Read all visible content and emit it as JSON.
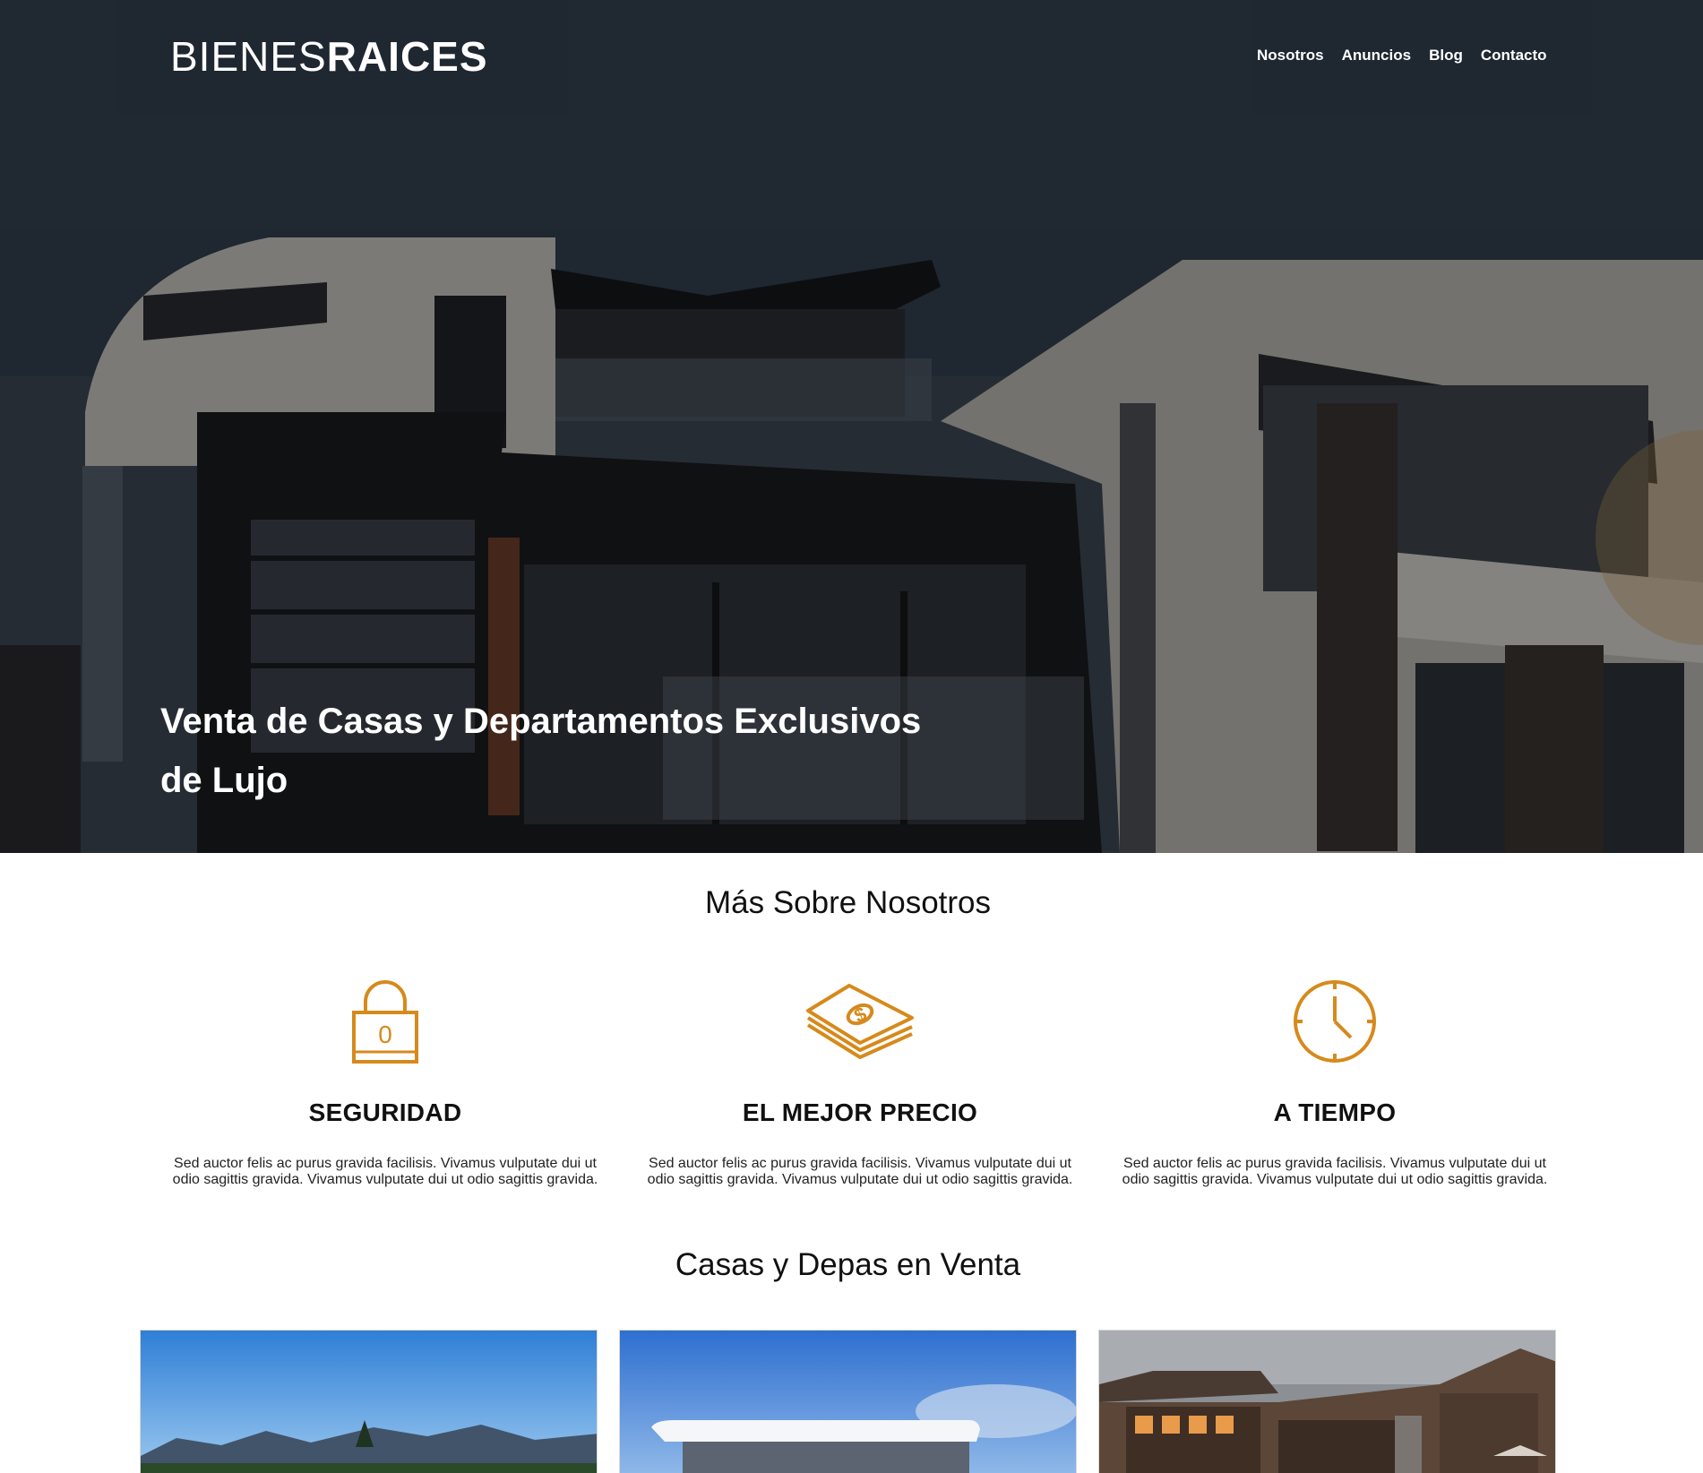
{
  "header": {
    "logo_light": "BIENES",
    "logo_bold": "RAICES",
    "nav": [
      {
        "label": "Nosotros"
      },
      {
        "label": "Anuncios"
      },
      {
        "label": "Blog"
      },
      {
        "label": "Contacto"
      }
    ]
  },
  "hero": {
    "title": "Venta de Casas y Departamentos Exclusivos de Lujo"
  },
  "about": {
    "title": "Más Sobre Nosotros",
    "features": [
      {
        "icon": "lock-icon",
        "title": "SEGURIDAD",
        "text": "Sed auctor felis ac purus gravida facilisis. Vivamus vulputate dui ut odio sagittis gravida. Vivamus vulputate dui ut odio sagittis gravida."
      },
      {
        "icon": "money-icon",
        "title": "EL MEJOR PRECIO",
        "text": "Sed auctor felis ac purus gravida facilisis. Vivamus vulputate dui ut odio sagittis gravida. Vivamus vulputate dui ut odio sagittis gravida."
      },
      {
        "icon": "clock-icon",
        "title": "A TIEMPO",
        "text": "Sed auctor felis ac purus gravida facilisis. Vivamus vulputate dui ut odio sagittis gravida. Vivamus vulputate dui ut odio sagittis gravida."
      }
    ]
  },
  "listings": {
    "title": "Casas y Depas en Venta"
  },
  "colors": {
    "accent": "#d68a1c",
    "text": "#111111",
    "white": "#ffffff"
  }
}
